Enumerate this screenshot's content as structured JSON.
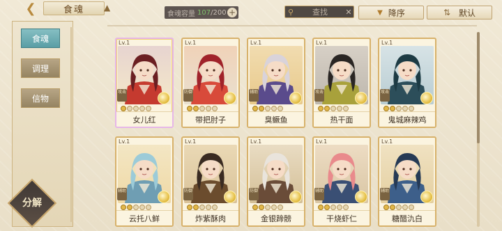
{
  "header": {
    "back_icon": "back-arrow-icon",
    "title": "食魂",
    "home_icon": "home-icon",
    "capacity_label": "食魂容量",
    "capacity_current": "107",
    "capacity_max": "/200",
    "capacity_add_icon": "plus-icon",
    "search_placeholder": "查找",
    "search_icon": "search-icon",
    "clear_icon": "close-icon",
    "sort_label": "降序",
    "sort_icon": "triangle-down-icon",
    "filter_label": "默认",
    "filter_icon": "sort-arrows-icon"
  },
  "sidebar": {
    "tabs": [
      {
        "label": "食魂",
        "active": true
      },
      {
        "label": "调理",
        "active": false
      },
      {
        "label": "信物",
        "active": false
      }
    ],
    "decompose_label": "分解"
  },
  "cards": [
    {
      "lv": "Lv.1",
      "name": "女儿红",
      "badge": "攻击",
      "stars": 1,
      "hair": "#6b1f22",
      "robe": "#c53a2f",
      "bg1": "#e7d4d0",
      "bg2": "#f4e8c8",
      "special": true
    },
    {
      "lv": "Lv.1",
      "name": "带把肘子",
      "badge": "防御",
      "stars": 2,
      "hair": "#a0222a",
      "robe": "#d84a3a",
      "bg1": "#f0d2b8",
      "bg2": "#e9e0cf",
      "special": false
    },
    {
      "lv": "Lv.1",
      "name": "臭鳜鱼",
      "badge": "辅助",
      "stars": 2,
      "hair": "#d9d3da",
      "robe": "#5a4b8c",
      "bg1": "#f1dcb0",
      "bg2": "#e8c98a",
      "special": false
    },
    {
      "lv": "Lv.1",
      "name": "热干面",
      "badge": "攻击",
      "stars": 2,
      "hair": "#2a2624",
      "robe": "#a8a13b",
      "bg1": "#d7d0c6",
      "bg2": "#bdb7ad",
      "special": false
    },
    {
      "lv": "Lv.1",
      "name": "鬼城麻辣鸡",
      "badge": "攻击",
      "stars": 2,
      "hair": "#1d3b44",
      "robe": "#2c4e5a",
      "bg1": "#d7e3e6",
      "bg2": "#b8ccd2",
      "special": false
    },
    {
      "lv": "Lv.1",
      "name": "云托八鲜",
      "badge": "辅助",
      "stars": 2,
      "hair": "#9ccbd8",
      "robe": "#6f9eb3",
      "bg1": "#f3e6c4",
      "bg2": "#efd9a5",
      "special": false
    },
    {
      "lv": "Lv.1",
      "name": "炸紫酥肉",
      "badge": "防御",
      "stars": 2,
      "hair": "#3a2b22",
      "robe": "#6b4c2d",
      "bg1": "#ead9b5",
      "bg2": "#d9c299",
      "special": false
    },
    {
      "lv": "Lv.1",
      "name": "金银蹄髈",
      "badge": "防御",
      "stars": 2,
      "hair": "#e9e4dc",
      "robe": "#6a4c38",
      "bg1": "#e9dcc3",
      "bg2": "#d4bf96",
      "special": false
    },
    {
      "lv": "Lv.1",
      "name": "干烧虾仁",
      "badge": "辅助",
      "stars": 2,
      "hair": "#e98a8c",
      "robe": "#3a4f74",
      "bg1": "#eddcc3",
      "bg2": "#d9c6a4",
      "special": false
    },
    {
      "lv": "Lv.1",
      "name": "糖醋氿白",
      "badge": "辅助",
      "stars": 2,
      "hair": "#263a55",
      "robe": "#3d5f8a",
      "bg1": "#f0e2c2",
      "bg2": "#e4cfa0",
      "special": false
    }
  ]
}
